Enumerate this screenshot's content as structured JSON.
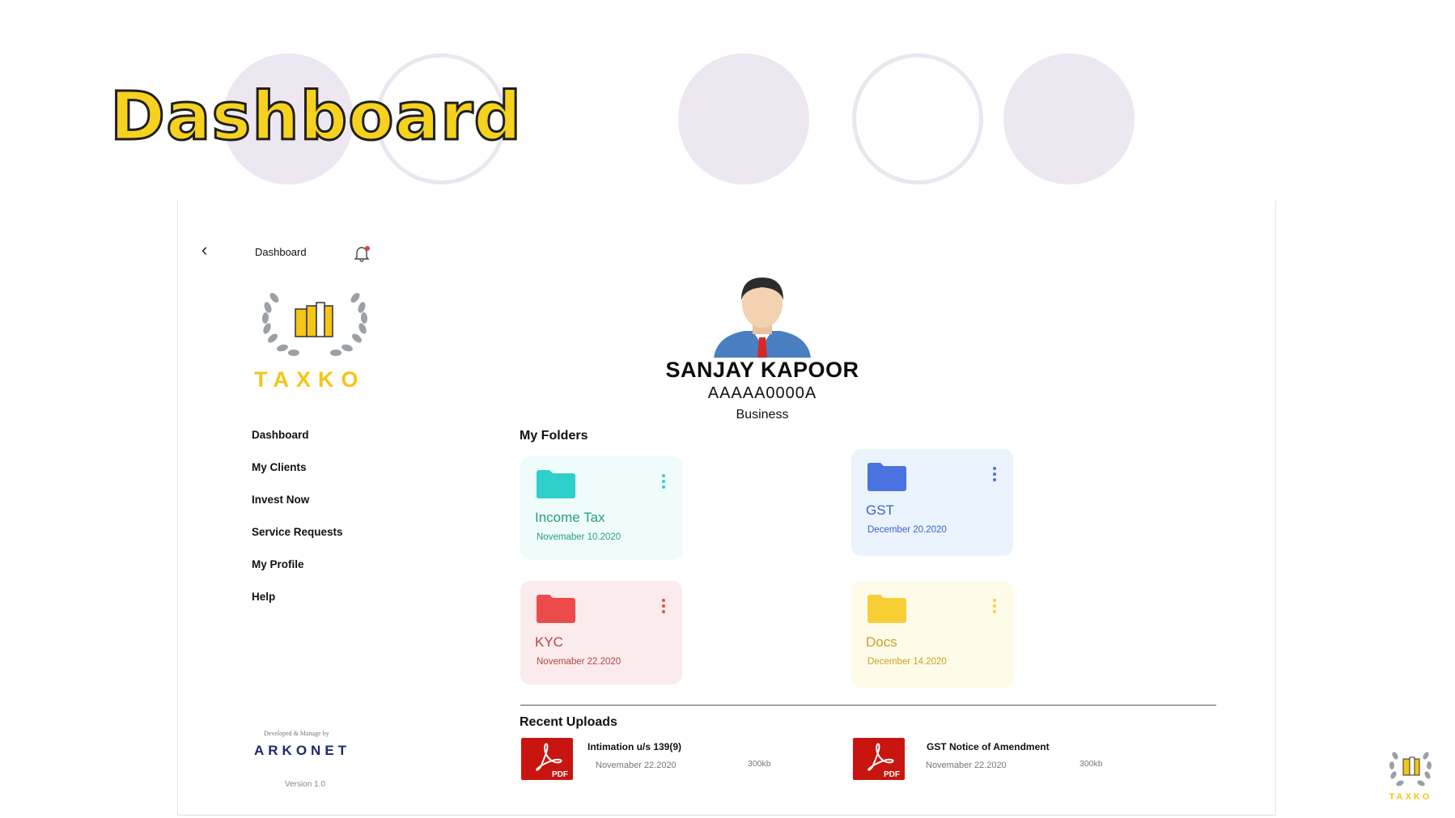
{
  "slide_title": "Dashboard",
  "sidebar": {
    "header_title": "Dashboard",
    "brand": "TAXKO",
    "nav_items": [
      {
        "label": "Dashboard",
        "active": false
      },
      {
        "label": "My Clients",
        "active": false
      },
      {
        "label": "Invest Now",
        "active": false
      },
      {
        "label": "Service Requests",
        "active": false
      },
      {
        "label": "My Profile",
        "active": true
      },
      {
        "label": "Help",
        "active": false
      }
    ],
    "developed_by": "Developed & Manage by",
    "developer": "ARKONET",
    "version": "Version 1.0"
  },
  "profile": {
    "name": "SANJAY KAPOOR",
    "id": "AAAAA0000A",
    "type": "Business"
  },
  "folders_section": {
    "title": "My Folders"
  },
  "folders": [
    {
      "name": "Income Tax",
      "date": "Novemaber 10.2020",
      "accent": "#2fd0cb",
      "text_color": "#2a9d7a",
      "bg": "#effcfb",
      "icon": "folder-icon"
    },
    {
      "name": "GST",
      "date": "December 20.2020",
      "accent": "#4a73e0",
      "text_color": "#3c63c7",
      "bg": "#ebf3fc",
      "icon": "folder-icon"
    },
    {
      "name": "KYC",
      "date": "Novemaber 22.2020",
      "accent": "#ec4b4b",
      "text_color": "#b34545",
      "bg": "#fcebec",
      "icon": "folder-icon"
    },
    {
      "name": "Docs",
      "date": "December 14.2020",
      "accent": "#f7cf35",
      "text_color": "#c7a324",
      "bg": "#fffbe9",
      "icon": "folder-icon"
    }
  ],
  "uploads_section": {
    "title": "Recent Uploads"
  },
  "uploads": [
    {
      "name": "Intimation u/s 139(9)",
      "date": "Novemaber 22.2020",
      "size": "300kb",
      "icon_label": "PDF"
    },
    {
      "name": "GST Notice of Amendment",
      "date": "Novemaber 22.2020",
      "size": "300kb",
      "icon_label": "PDF"
    }
  ],
  "corner_brand": "TAXKO"
}
